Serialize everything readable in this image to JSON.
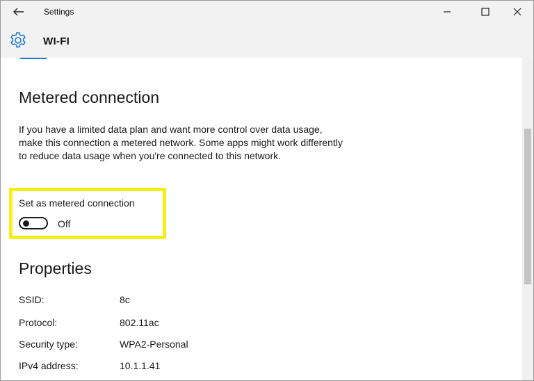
{
  "window": {
    "title": "Settings"
  },
  "header": {
    "page_title": "WI-FI"
  },
  "metered": {
    "heading": "Metered connection",
    "description": "If you have a limited data plan and want more control over data usage, make this connection a metered network. Some apps might work differently to reduce data usage when you're connected to this network.",
    "toggle_label": "Set as metered connection",
    "toggle_state": "Off",
    "toggle_on": false,
    "highlight_color": "#f6ee1a"
  },
  "properties": {
    "heading": "Properties",
    "rows": [
      {
        "label": "SSID:",
        "value": "8c"
      },
      {
        "label": "Protocol:",
        "value": "802.11ac"
      },
      {
        "label": "Security type:",
        "value": "WPA2-Personal"
      },
      {
        "label": "IPv4 address:",
        "value": "10.1.1.41"
      }
    ]
  },
  "colors": {
    "accent": "#1f7bd0",
    "titlebar_bg": "#f2f2f2"
  },
  "icons": {
    "back": "back-arrow-icon",
    "gear": "gear-icon",
    "minimize": "minimize-icon",
    "maximize": "maximize-icon",
    "close": "close-icon"
  }
}
